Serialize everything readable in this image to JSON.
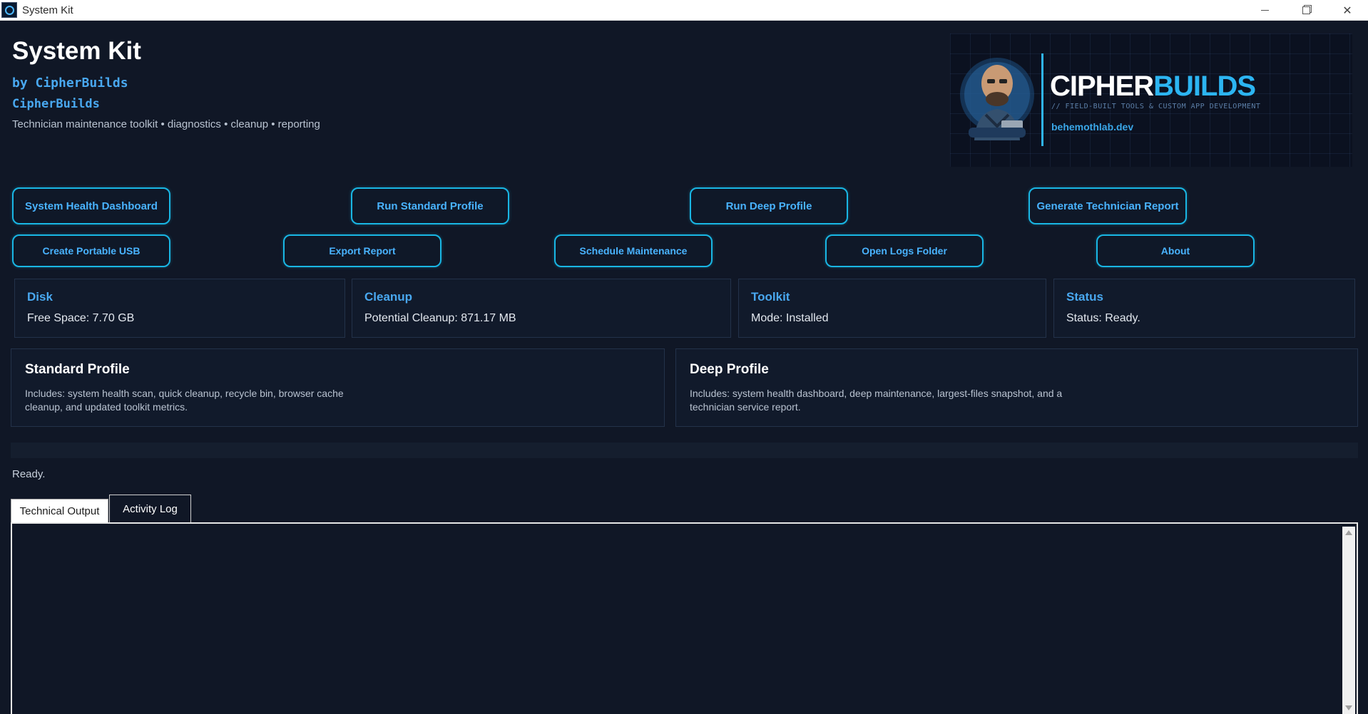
{
  "window": {
    "title": "System Kit"
  },
  "header": {
    "title": "System Kit",
    "byline": "by CipherBuilds",
    "brand": "CipherBuilds",
    "tagline": "Technician maintenance toolkit • diagnostics • cleanup • reporting"
  },
  "logo": {
    "word_part1": "CIPHER",
    "word_part2": "BUILDS",
    "subtitle": "// FIELD-BUILT TOOLS & CUSTOM APP DEVELOPMENT",
    "url": "behemothlab.dev"
  },
  "buttons_row1": [
    {
      "label": "System Health Dashboard"
    },
    {
      "label": "Run Standard Profile"
    },
    {
      "label": "Run Deep Profile"
    },
    {
      "label": "Generate Technician Report"
    }
  ],
  "buttons_row2": [
    {
      "label": "Create Portable USB"
    },
    {
      "label": "Export Report"
    },
    {
      "label": "Schedule Maintenance"
    },
    {
      "label": "Open Logs Folder"
    },
    {
      "label": "About"
    }
  ],
  "stats": [
    {
      "title": "Disk",
      "value": "Free Space: 7.70 GB"
    },
    {
      "title": "Cleanup",
      "value": "Potential Cleanup: 871.17 MB"
    },
    {
      "title": "Toolkit",
      "value": "Mode: Installed"
    },
    {
      "title": "Status",
      "value": "Status: Ready."
    }
  ],
  "profiles": [
    {
      "title": "Standard Profile",
      "description": "Includes: system health scan, quick cleanup, recycle bin, browser cache cleanup, and updated toolkit metrics."
    },
    {
      "title": "Deep Profile",
      "description": "Includes: system health dashboard, deep maintenance, largest-files snapshot, and a technician service report."
    }
  ],
  "progress": {
    "fraction": 0
  },
  "status_text": "Ready.",
  "tabs": [
    {
      "label": "Technical Output",
      "active": true
    },
    {
      "label": "Activity Log",
      "active": false
    }
  ],
  "colors": {
    "background": "#101726",
    "accent": "#19b6e4",
    "label_blue": "#49a8f0"
  }
}
